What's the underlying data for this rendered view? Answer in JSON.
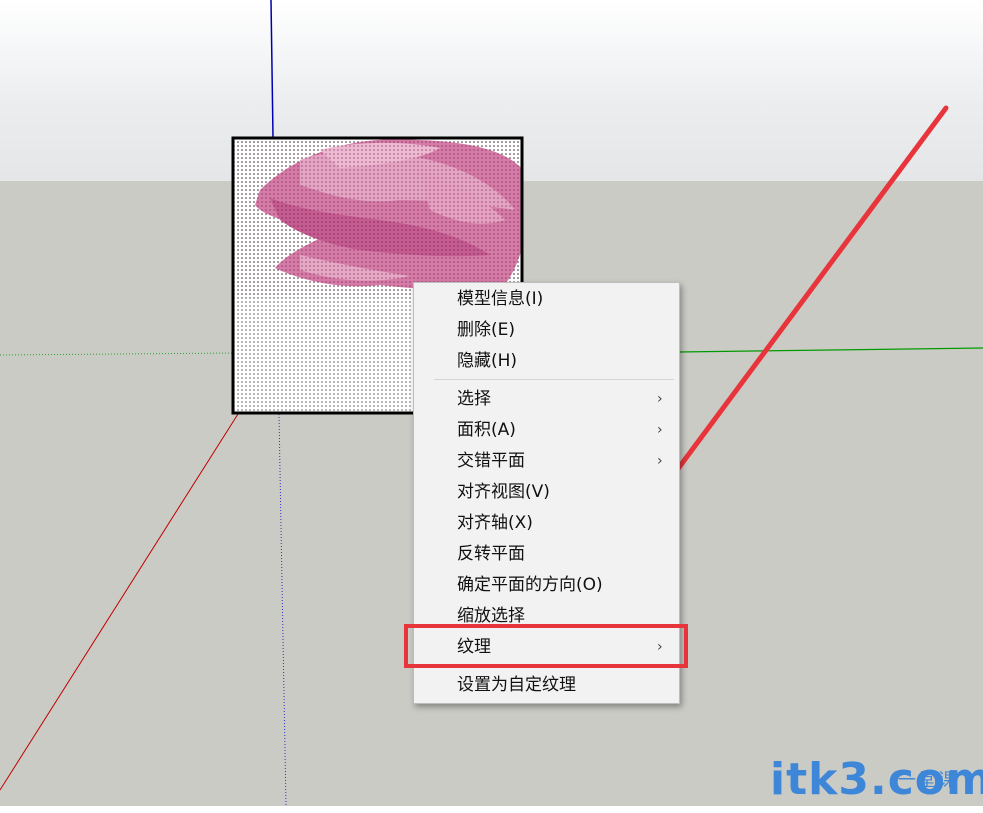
{
  "context_menu": {
    "items": [
      {
        "label": "模型信息(I)",
        "submenu": false
      },
      {
        "label": "删除(E)",
        "submenu": false
      },
      {
        "label": "隐藏(H)",
        "submenu": false
      },
      {
        "label": "选择",
        "submenu": true
      },
      {
        "label": "面积(A)",
        "submenu": true
      },
      {
        "label": "交错平面",
        "submenu": true
      },
      {
        "label": "对齐视图(V)",
        "submenu": false
      },
      {
        "label": "对齐轴(X)",
        "submenu": false
      },
      {
        "label": "反转平面",
        "submenu": false
      },
      {
        "label": "确定平面的方向(O)",
        "submenu": false
      },
      {
        "label": "缩放选择",
        "submenu": false
      },
      {
        "label": "纹理",
        "submenu": true,
        "highlighted": true
      },
      {
        "label": "设置为自定纹理",
        "submenu": false
      }
    ],
    "submenu_arrow": "›"
  },
  "annotation": {
    "color": "#e8353c"
  },
  "watermark": {
    "brand": "itk3.com",
    "subtitle": "一堂课",
    "color": "#3d86d8"
  },
  "colors": {
    "ground": "#cbcbc6",
    "sky": "#ffffff",
    "axis_red": "#c00000",
    "axis_green": "#009a00",
    "axis_blue": "#0000b0",
    "rose": "#d77aa8"
  }
}
